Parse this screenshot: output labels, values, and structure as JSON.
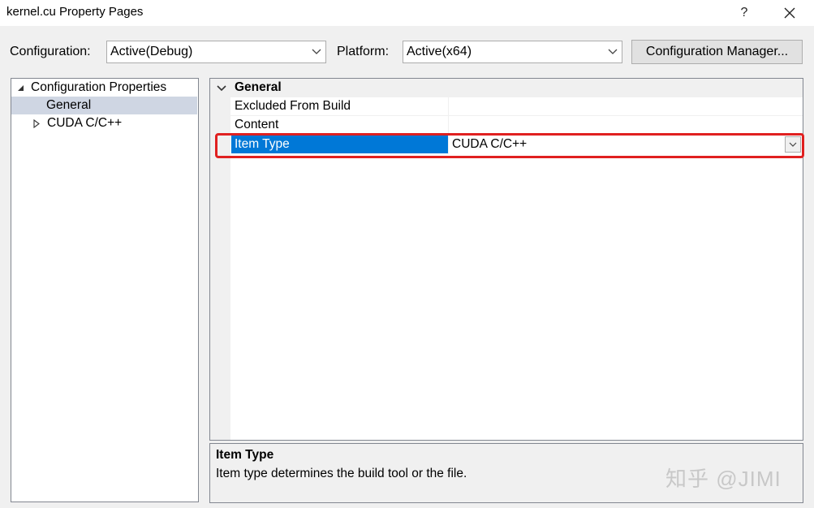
{
  "window": {
    "title": "kernel.cu Property Pages",
    "help_label": "?",
    "close_icon": "close-icon"
  },
  "toolbar": {
    "configuration_label": "Configuration:",
    "configuration_value": "Active(Debug)",
    "platform_label": "Platform:",
    "platform_value": "Active(x64)",
    "config_manager_label": "Configuration Manager..."
  },
  "tree": {
    "root_label": "Configuration Properties",
    "items": [
      {
        "label": "General",
        "selected": true
      },
      {
        "label": "CUDA C/C++",
        "selected": false
      }
    ]
  },
  "grid": {
    "section_label": "General",
    "rows": [
      {
        "name": "Excluded From Build",
        "value": ""
      },
      {
        "name": "Content",
        "value": ""
      },
      {
        "name": "Item Type",
        "value": "CUDA C/C++",
        "selected": true
      }
    ],
    "highlight_color": "#e02020"
  },
  "description": {
    "title": "Item Type",
    "text": "Item type determines the build tool or the file."
  },
  "watermark": "知乎 @JIMI"
}
